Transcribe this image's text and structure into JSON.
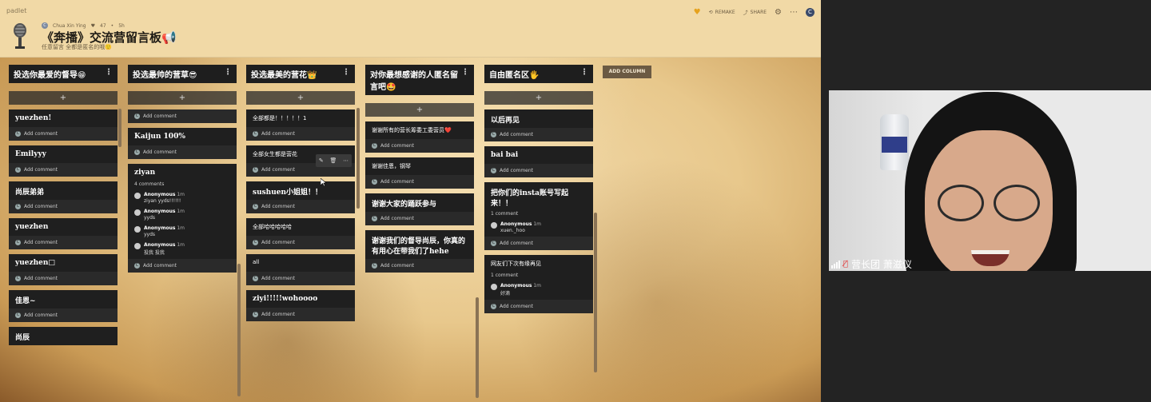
{
  "app": {
    "brand": "padlet"
  },
  "header": {
    "author": "Chua Xin Ying",
    "likes": "47",
    "age": "5h",
    "title": "《奔播》交流营留言板📢",
    "subtitle": "任意留言 全都是匿名的哦🙂",
    "actions": {
      "remake": "REMAKE",
      "share": "SHARE"
    },
    "avatar_letter": "C"
  },
  "columns": [
    {
      "title": "投选你最爱的督导😁",
      "cards": [
        {
          "text": "yuezhen!",
          "comments": [],
          "foot": "Add comment"
        },
        {
          "text": "Emilyyy",
          "comments": [],
          "foot": "Add comment"
        },
        {
          "text": "尚辰弟弟",
          "comments": [],
          "foot": "Add comment"
        },
        {
          "text": "yuezhen",
          "comments": [],
          "foot": "Add comment"
        },
        {
          "text": "yuezhen□",
          "comments": [],
          "foot": "Add comment"
        },
        {
          "text": "佳恩~",
          "comments": [],
          "foot": "Add comment"
        },
        {
          "text": "尚辰",
          "comments": [],
          "foot": ""
        }
      ]
    },
    {
      "title": "投选最帅的营草😎",
      "cards": [
        {
          "text": "",
          "comments": [],
          "foot": "Add comment"
        },
        {
          "text": "Kaijun 100%",
          "comments": [],
          "foot": "Add comment"
        },
        {
          "text": "ziyan",
          "count": "4 comments",
          "comments": [
            {
              "who": "Anonymous",
              "when": "1m",
              "txt": "ziyan yyds!!!!!!"
            },
            {
              "who": "Anonymous",
              "when": "1m",
              "txt": "yyds"
            },
            {
              "who": "Anonymous",
              "when": "1m",
              "txt": "yyds"
            },
            {
              "who": "Anonymous",
              "when": "1m",
              "txt": "投我 投我"
            }
          ],
          "foot": "Add comment"
        }
      ]
    },
    {
      "title": "投选最美的营花👑",
      "cards": [
        {
          "text": "全部都是！！！！！1",
          "light": true,
          "comments": [],
          "foot": "Add comment"
        },
        {
          "text": "全部女生都是营花",
          "light": true,
          "comments": [],
          "foot": "Add comment"
        },
        {
          "text": "sushuen小姐姐！！",
          "comments": [],
          "foot": "Add comment"
        },
        {
          "text": "全部哈哈哈哈哈",
          "light": true,
          "comments": [],
          "foot": "Add comment"
        },
        {
          "text": "all",
          "light": true,
          "comments": [],
          "foot": "Add comment"
        },
        {
          "text": "ziyi!!!!!wohoooo",
          "comments": [],
          "foot": "Add comment"
        }
      ]
    },
    {
      "title": "对你最想感谢的人匿名留言吧🤩",
      "cards": [
        {
          "text": "谢谢所有的营长筹委工委营员❤️",
          "light": true,
          "comments": [],
          "foot": "Add comment"
        },
        {
          "text": "谢谢佳恩，钢琴",
          "light": true,
          "comments": [],
          "foot": "Add comment"
        },
        {
          "text": "谢谢大家的踊跃参与",
          "comments": [],
          "foot": "Add comment"
        },
        {
          "text": "谢谢我们的督导尚辰，你真的有用心在带我们了hehe",
          "comments": [],
          "foot": "Add comment"
        }
      ]
    },
    {
      "title": "自由匿名区🖐",
      "cards": [
        {
          "text": "以后再见",
          "comments": [],
          "foot": "Add comment"
        },
        {
          "text": "bai bai",
          "comments": [],
          "foot": "Add comment"
        },
        {
          "text": "把你们的insta账号写起来！！",
          "count": "1 comment",
          "comments": [
            {
              "who": "Anonymous",
              "when": "1m",
              "txt": "xuen._hoo"
            }
          ],
          "foot": "Add comment"
        },
        {
          "text": "网友们下次有缘再见",
          "light": true,
          "count": "1 comment",
          "comments": [
            {
              "who": "Anonymous",
              "when": "1m",
              "txt": "好滴"
            }
          ],
          "foot": "Add comment"
        }
      ]
    }
  ],
  "add_symbol": "+",
  "add_column": "ADD COLUMN",
  "webcam": {
    "name": "营长团 萧滋仪"
  }
}
